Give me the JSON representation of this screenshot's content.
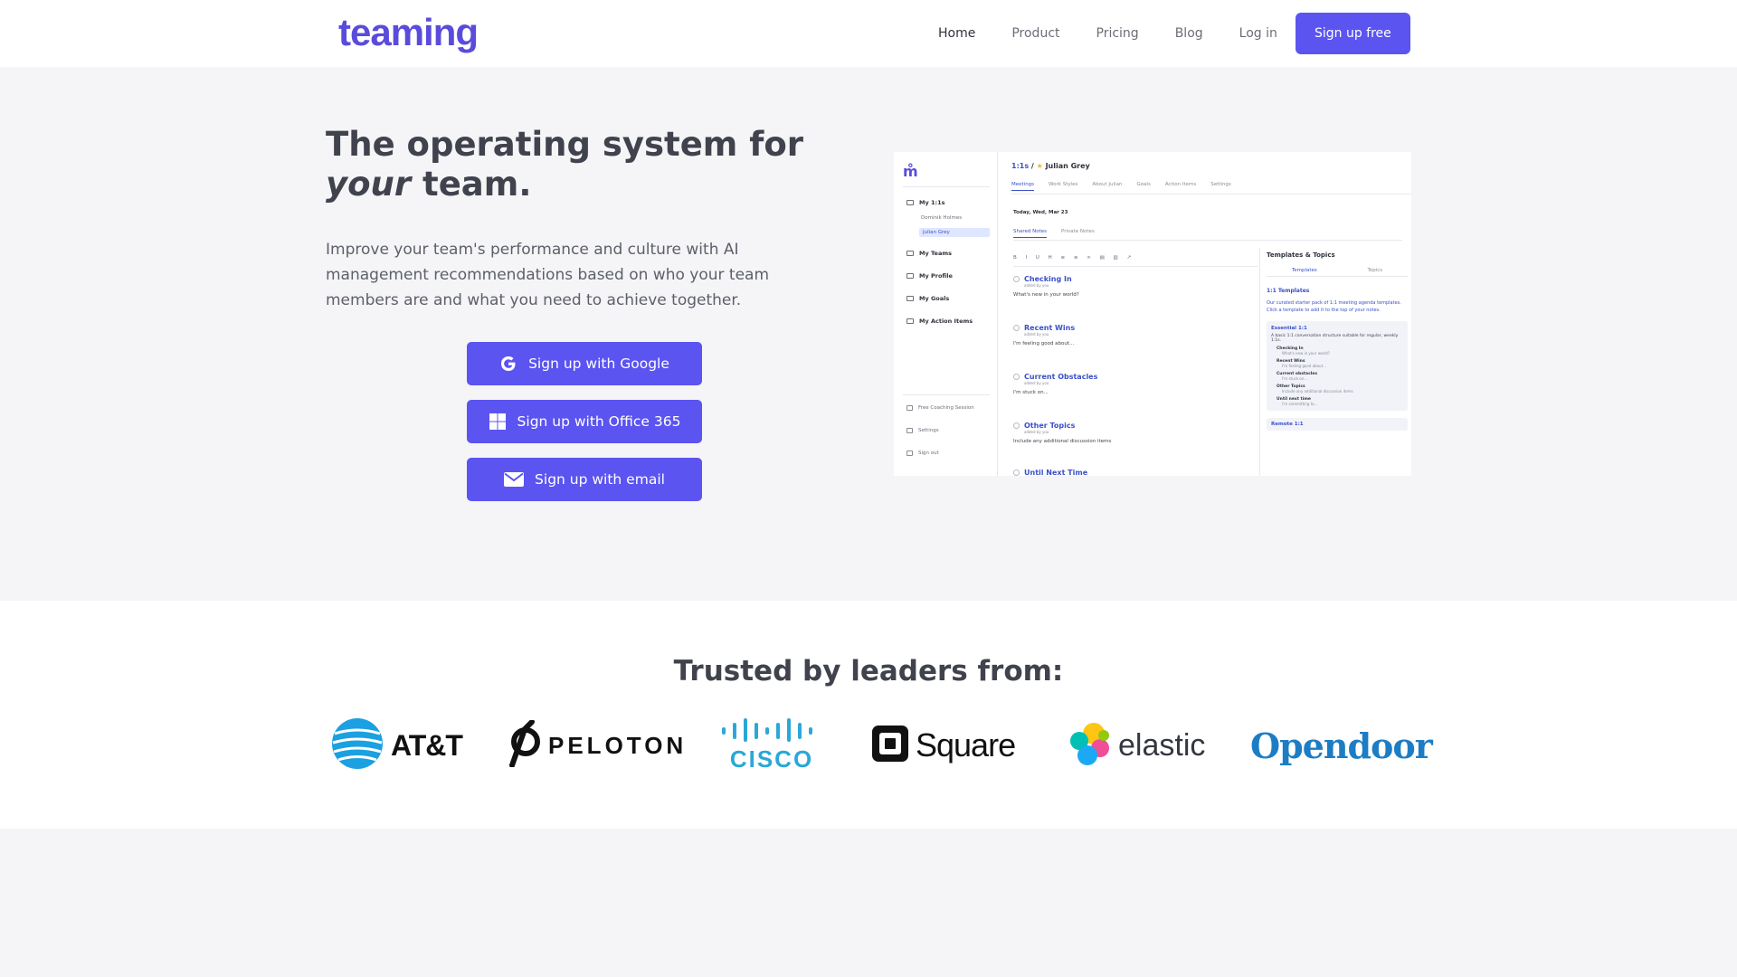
{
  "header": {
    "logo_text": "teaming",
    "nav": {
      "home": "Home",
      "product": "Product",
      "pricing": "Pricing",
      "blog": "Blog",
      "login": "Log in",
      "signup": "Sign up free"
    }
  },
  "hero": {
    "title_line1": "The operating system for",
    "title_em": "your",
    "title_rest": " team.",
    "description": "Improve your team's performance and culture with AI management recommendations based on who your team members are and what you need to achieve together.",
    "cta_google": "Sign up with Google",
    "cta_office": "Sign up with Office 365",
    "cta_email": "Sign up with email"
  },
  "preview": {
    "sidebar": {
      "my_1on1s": "My 1:1s",
      "sub1": "Dominik Holmes",
      "sub2": "Julian Grey",
      "my_teams": "My Teams",
      "my_profile": "My Profile",
      "my_goals": "My Goals",
      "my_action_items": "My Action Items",
      "coaching": "Free Coaching Session",
      "settings": "Settings",
      "signout": "Sign out"
    },
    "crumb_link": "1:1s",
    "crumb_sep": " / ",
    "crumb_star": "★",
    "crumb_name": "Julian Grey",
    "tabs": [
      "Meetings",
      "Work Styles",
      "About Julian",
      "Goals",
      "Action Items",
      "Settings"
    ],
    "date": "Today, Wed, Mar 23",
    "notes_tabs": [
      "Shared Notes",
      "Private Notes"
    ],
    "toolbar": "B I U H ≡ ≡ ∞ ▤ ▥ ↗",
    "topics": [
      {
        "title": "Checking In",
        "by": "added by you",
        "body": "What's new in your world?"
      },
      {
        "title": "Recent Wins",
        "by": "added by you",
        "body": "I'm feeling good about..."
      },
      {
        "title": "Current Obstacles",
        "by": "added by you",
        "body": "I'm stuck on..."
      },
      {
        "title": "Other Topics",
        "by": "added by you",
        "body": "Include any additional discussion items"
      },
      {
        "title": "Until Next Time",
        "by": "",
        "body": ""
      }
    ],
    "side": {
      "title": "Templates & Topics",
      "tab_templates": "Templates",
      "tab_topics": "Topics",
      "section": "1:1 Templates",
      "desc": "Our curated starter pack of 1:1 meeting agenda templates. Click a template to add it to the top of your notes.",
      "card_title": "Essential 1:1",
      "card_desc": "A basic 1:1 conversation structure suitable for regular, weekly 1:1s.",
      "card_items": [
        {
          "t": "Checking In",
          "s": "What's new in your world?"
        },
        {
          "t": "Recent Wins",
          "s": "I'm feeling good about..."
        },
        {
          "t": "Current obstacles",
          "s": "I'm stuck on..."
        },
        {
          "t": "Other Topics",
          "s": "Include any additional discussion items"
        },
        {
          "t": "Until next time",
          "s": "I'm committing to..."
        }
      ],
      "card2": "Remote 1:1"
    }
  },
  "trusted": {
    "title": "Trusted by leaders from:",
    "brands": [
      "AT&T",
      "PELOTON",
      "CISCO",
      "Square",
      "elastic",
      "Opendoor"
    ]
  },
  "colors": {
    "brand": "#5b54f0",
    "logo": "#5a4cdb",
    "link": "#3b50c8"
  }
}
